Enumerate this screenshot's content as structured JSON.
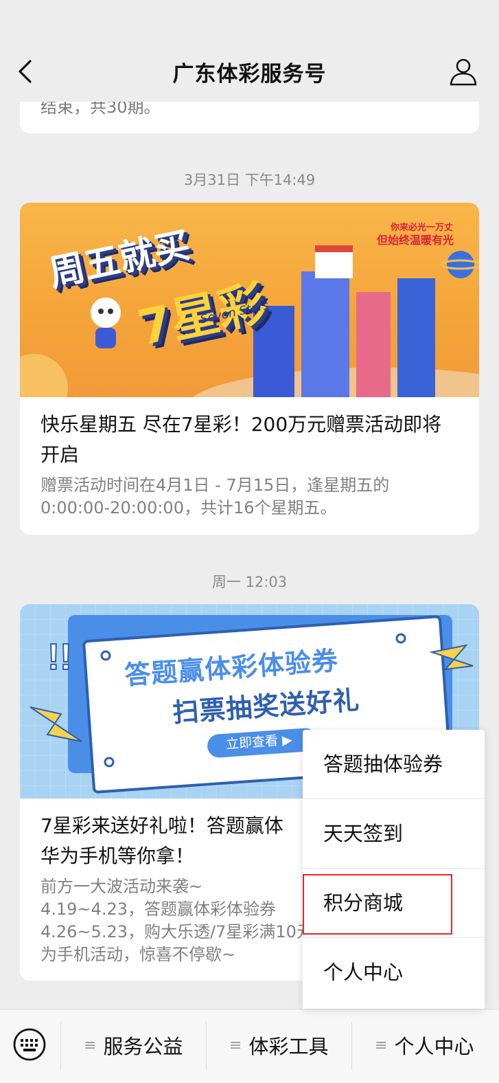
{
  "header": {
    "title": "广东体彩服务号"
  },
  "messages": [
    {
      "snippet": "结束，共30期。"
    },
    {
      "timestamp": "3月31日 下午14:49",
      "banner": {
        "headline": "周五就买",
        "headline2": "7星彩",
        "sub": "Seven Stars",
        "slogan1": "你来必光一万丈",
        "slogan2": "但始终温暖有光"
      },
      "title": "快乐星期五 尽在7星彩！200万元赠票活动即将开启",
      "desc": "赠票活动时间在4月1日 - 7月15日，逢星期五的0:00:00-20:00:00，共计16个星期五。"
    },
    {
      "timestamp": "周一 12:03",
      "banner": {
        "line1": "答题赢体彩体验券",
        "line2": "扫票抽奖送好礼",
        "button": "立即查看 ▶"
      },
      "title": "7星彩来送好礼啦！答题赢体",
      "title2": "华为手机等你拿！",
      "desc_lines": [
        "前方一大波活动来袭~",
        "4.19~4.23，答题赢体彩体验券",
        "4.26~5.23，购大乐透/7星彩满10元",
        "为手机活动，惊喜不停歇~"
      ]
    }
  ],
  "popup_menu": {
    "items": [
      "答题抽体验券",
      "天天签到",
      "积分商城",
      "个人中心"
    ],
    "highlighted": "积分商城"
  },
  "bottom_bar": {
    "tabs": [
      "服务公益",
      "体彩工具",
      "个人中心"
    ]
  },
  "colors": {
    "highlight": "#e8262b",
    "background": "#ededed"
  }
}
